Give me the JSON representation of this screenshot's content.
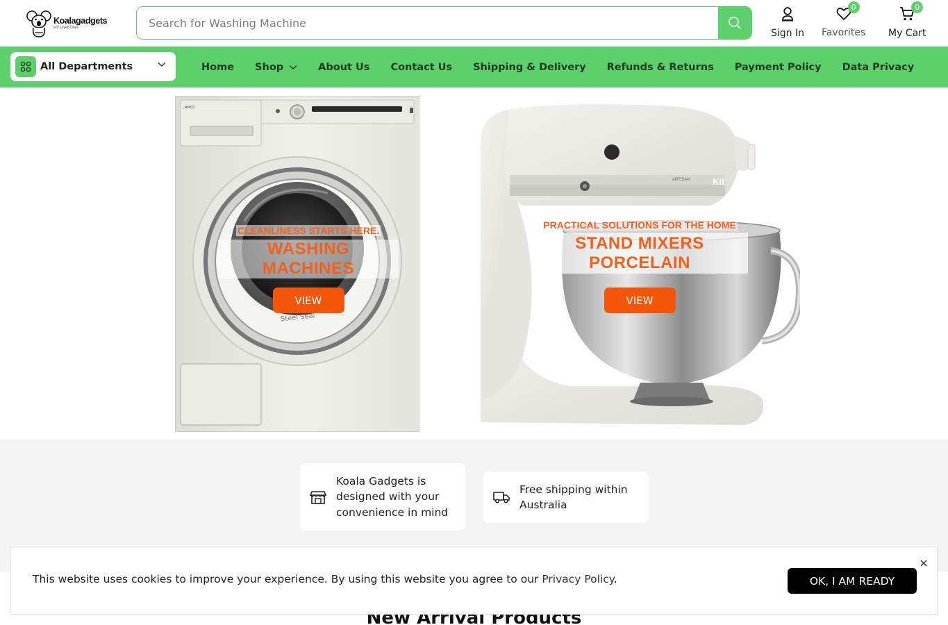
{
  "brand": {
    "name": "Koalagadgets",
    "tagline": "For Loved Ones"
  },
  "search": {
    "placeholder": "Search for Washing Machine"
  },
  "header_actions": {
    "sign_in": "Sign In",
    "favorites": "Favorites",
    "favorites_count": "0",
    "cart": "My Cart",
    "cart_count": "0"
  },
  "departments": {
    "label": "All Departments"
  },
  "nav": {
    "home": "Home",
    "shop": "Shop",
    "about": "About Us",
    "contact": "Contact Us",
    "shipping": "Shipping & Delivery",
    "refunds": "Refunds & Returns",
    "payment": "Payment Policy",
    "privacy": "Data Privacy"
  },
  "banners": {
    "washing": {
      "kicker": "CLEANLINESS STARTS HERE.",
      "headline": "WASHING MACHINES",
      "button": "VIEW",
      "machine_brand": "ASKO",
      "machine_badge": "Steel Seal"
    },
    "mixer": {
      "kicker": "PRACTICAL SOLUTIONS FOR THE HOME",
      "headline_line1": "STAND MIXERS",
      "headline_line2": "PORCELAIN",
      "button": "VIEW",
      "mixer_label": "ARTISAN",
      "mixer_brand": "Kit"
    }
  },
  "features": {
    "convenience": "Koala Gadgets is designed with your convenience in mind",
    "shipping": "Free shipping within Australia"
  },
  "section_title": "New Arrival Products",
  "cookie": {
    "text": "This website uses cookies to improve your experience. By using this website you agree to our ",
    "link": "Privacy Policy",
    "suffix": ".",
    "button": "OK, I AM READY"
  },
  "colors": {
    "accent_green": "#5cd06a",
    "accent_orange": "#f55508",
    "headline_orange": "#f2611b"
  },
  "icons": [
    "koala-logo-icon",
    "search-icon",
    "user-icon",
    "heart-icon",
    "cart-icon",
    "grid-icon",
    "chevron-down-icon",
    "store-icon",
    "truck-icon",
    "close-icon"
  ]
}
